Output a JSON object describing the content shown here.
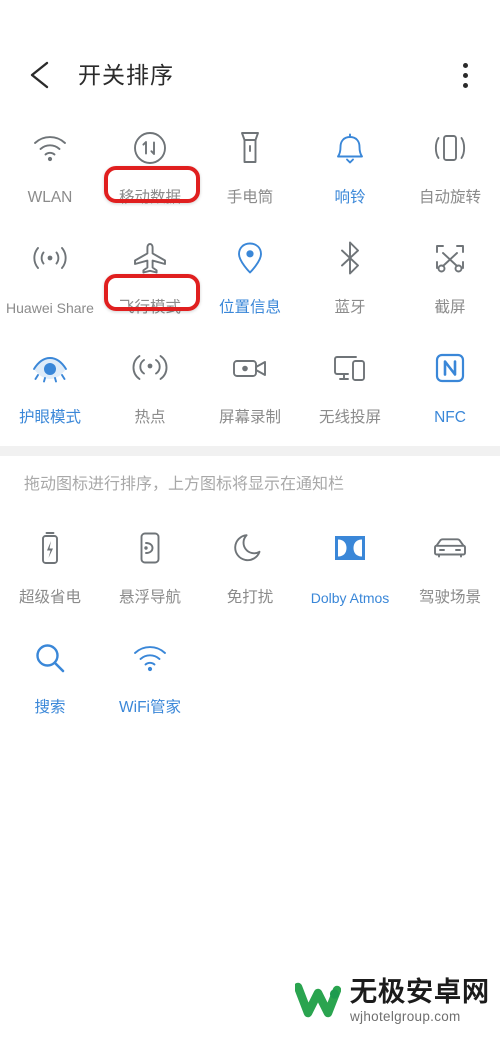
{
  "appbar": {
    "back_icon": "back-arrow-icon",
    "title": "开关排序",
    "menu_icon": "overflow-menu-icon"
  },
  "colors": {
    "accent_blue": "#3a87d8",
    "inactive_gray": "#8b8b8b",
    "icon_gray": "#6f7478",
    "annotation_red": "#e01f1f",
    "divider": "#f1f1f1",
    "title": "#2b2b2b"
  },
  "top_section": {
    "tiles": [
      {
        "label": "WLAN",
        "icon": "wifi-icon",
        "active": false
      },
      {
        "label": "移动数据",
        "icon": "mobile-data-icon",
        "active": false,
        "annotated": true
      },
      {
        "label": "手电筒",
        "icon": "flashlight-icon",
        "active": false
      },
      {
        "label": "响铃",
        "icon": "ringer-bell-icon",
        "active": true
      },
      {
        "label": "自动旋转",
        "icon": "auto-rotate-icon",
        "active": false
      },
      {
        "label": "Huawei Share",
        "icon": "huawei-share-icon",
        "active": false
      },
      {
        "label": "飞行模式",
        "icon": "airplane-mode-icon",
        "active": false,
        "annotated": true
      },
      {
        "label": "位置信息",
        "icon": "location-pin-icon",
        "active": true
      },
      {
        "label": "蓝牙",
        "icon": "bluetooth-icon",
        "active": false
      },
      {
        "label": "截屏",
        "icon": "screenshot-scissors-icon",
        "active": false
      },
      {
        "label": "护眼模式",
        "icon": "eye-comfort-icon",
        "active": true
      },
      {
        "label": "热点",
        "icon": "hotspot-icon",
        "active": false
      },
      {
        "label": "屏幕录制",
        "icon": "screen-record-icon",
        "active": false
      },
      {
        "label": "无线投屏",
        "icon": "wireless-cast-icon",
        "active": false
      },
      {
        "label": "NFC",
        "icon": "nfc-icon",
        "active": true
      }
    ]
  },
  "hint": "拖动图标进行排序，上方图标将显示在通知栏",
  "bottom_section": {
    "tiles": [
      {
        "label": "超级省电",
        "icon": "battery-saver-icon",
        "active": false
      },
      {
        "label": "悬浮导航",
        "icon": "floating-nav-icon",
        "active": false
      },
      {
        "label": "免打扰",
        "icon": "do-not-disturb-moon-icon",
        "active": false
      },
      {
        "label": "Dolby Atmos",
        "icon": "dolby-atmos-icon",
        "active": true
      },
      {
        "label": "驾驶场景",
        "icon": "driving-mode-car-icon",
        "active": false
      },
      {
        "label": "搜索",
        "icon": "search-icon",
        "active": true
      },
      {
        "label": "WiFi管家",
        "icon": "wifi-manager-icon",
        "active": true
      }
    ]
  },
  "watermark": {
    "logo_icon": "wj-w-logo-icon",
    "name": "无极安卓网",
    "url": "wjhotelgroup.com"
  }
}
